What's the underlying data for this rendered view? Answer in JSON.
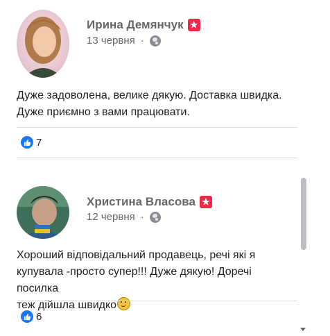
{
  "comments": [
    {
      "author": "Ирина Демянчук",
      "date": "13 червня",
      "separator": "·",
      "text_lines": [
        "Дуже задоволена, велике дякую. Доставка швидка.",
        "Дуже приємно з вами працювати."
      ],
      "likes": "7"
    },
    {
      "author": "Христина Власова",
      "date": "12 червня",
      "separator": "·",
      "text_lines": [
        "Хороший відповідальний продавець, речі які я",
        "купувала -просто супер!!! Дуже дякую! Доречі посилка",
        "теж дійшла швидко"
      ],
      "likes": "6"
    }
  ],
  "icons": {
    "recommend_badge": "star-badge-icon",
    "privacy": "globe-icon",
    "like": "like-thumb-icon",
    "emoji": "smile-emoji-icon"
  },
  "colors": {
    "like_blue": "#1877f2",
    "badge_red": "#f02849",
    "muted_text": "#65676b"
  }
}
